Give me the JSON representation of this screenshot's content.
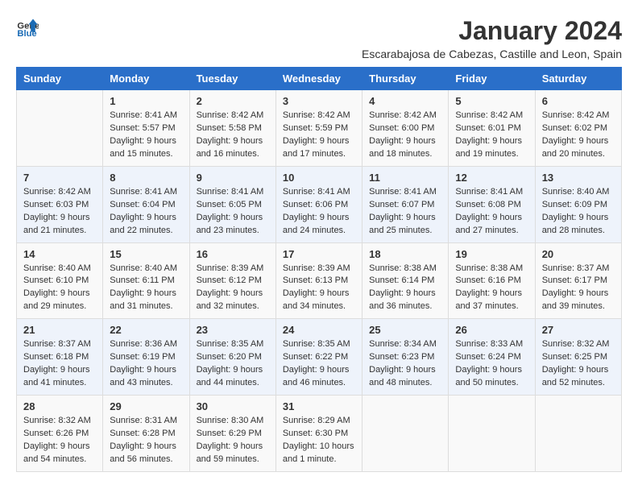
{
  "logo": {
    "general": "General",
    "blue": "Blue"
  },
  "title": "January 2024",
  "subtitle": "Escarabajosa de Cabezas, Castille and Leon, Spain",
  "days_of_week": [
    "Sunday",
    "Monday",
    "Tuesday",
    "Wednesday",
    "Thursday",
    "Friday",
    "Saturday"
  ],
  "weeks": [
    [
      {
        "day": "",
        "content": ""
      },
      {
        "day": "1",
        "content": "Sunrise: 8:41 AM\nSunset: 5:57 PM\nDaylight: 9 hours\nand 15 minutes."
      },
      {
        "day": "2",
        "content": "Sunrise: 8:42 AM\nSunset: 5:58 PM\nDaylight: 9 hours\nand 16 minutes."
      },
      {
        "day": "3",
        "content": "Sunrise: 8:42 AM\nSunset: 5:59 PM\nDaylight: 9 hours\nand 17 minutes."
      },
      {
        "day": "4",
        "content": "Sunrise: 8:42 AM\nSunset: 6:00 PM\nDaylight: 9 hours\nand 18 minutes."
      },
      {
        "day": "5",
        "content": "Sunrise: 8:42 AM\nSunset: 6:01 PM\nDaylight: 9 hours\nand 19 minutes."
      },
      {
        "day": "6",
        "content": "Sunrise: 8:42 AM\nSunset: 6:02 PM\nDaylight: 9 hours\nand 20 minutes."
      }
    ],
    [
      {
        "day": "7",
        "content": "Sunrise: 8:42 AM\nSunset: 6:03 PM\nDaylight: 9 hours\nand 21 minutes."
      },
      {
        "day": "8",
        "content": "Sunrise: 8:41 AM\nSunset: 6:04 PM\nDaylight: 9 hours\nand 22 minutes."
      },
      {
        "day": "9",
        "content": "Sunrise: 8:41 AM\nSunset: 6:05 PM\nDaylight: 9 hours\nand 23 minutes."
      },
      {
        "day": "10",
        "content": "Sunrise: 8:41 AM\nSunset: 6:06 PM\nDaylight: 9 hours\nand 24 minutes."
      },
      {
        "day": "11",
        "content": "Sunrise: 8:41 AM\nSunset: 6:07 PM\nDaylight: 9 hours\nand 25 minutes."
      },
      {
        "day": "12",
        "content": "Sunrise: 8:41 AM\nSunset: 6:08 PM\nDaylight: 9 hours\nand 27 minutes."
      },
      {
        "day": "13",
        "content": "Sunrise: 8:40 AM\nSunset: 6:09 PM\nDaylight: 9 hours\nand 28 minutes."
      }
    ],
    [
      {
        "day": "14",
        "content": "Sunrise: 8:40 AM\nSunset: 6:10 PM\nDaylight: 9 hours\nand 29 minutes."
      },
      {
        "day": "15",
        "content": "Sunrise: 8:40 AM\nSunset: 6:11 PM\nDaylight: 9 hours\nand 31 minutes."
      },
      {
        "day": "16",
        "content": "Sunrise: 8:39 AM\nSunset: 6:12 PM\nDaylight: 9 hours\nand 32 minutes."
      },
      {
        "day": "17",
        "content": "Sunrise: 8:39 AM\nSunset: 6:13 PM\nDaylight: 9 hours\nand 34 minutes."
      },
      {
        "day": "18",
        "content": "Sunrise: 8:38 AM\nSunset: 6:14 PM\nDaylight: 9 hours\nand 36 minutes."
      },
      {
        "day": "19",
        "content": "Sunrise: 8:38 AM\nSunset: 6:16 PM\nDaylight: 9 hours\nand 37 minutes."
      },
      {
        "day": "20",
        "content": "Sunrise: 8:37 AM\nSunset: 6:17 PM\nDaylight: 9 hours\nand 39 minutes."
      }
    ],
    [
      {
        "day": "21",
        "content": "Sunrise: 8:37 AM\nSunset: 6:18 PM\nDaylight: 9 hours\nand 41 minutes."
      },
      {
        "day": "22",
        "content": "Sunrise: 8:36 AM\nSunset: 6:19 PM\nDaylight: 9 hours\nand 43 minutes."
      },
      {
        "day": "23",
        "content": "Sunrise: 8:35 AM\nSunset: 6:20 PM\nDaylight: 9 hours\nand 44 minutes."
      },
      {
        "day": "24",
        "content": "Sunrise: 8:35 AM\nSunset: 6:22 PM\nDaylight: 9 hours\nand 46 minutes."
      },
      {
        "day": "25",
        "content": "Sunrise: 8:34 AM\nSunset: 6:23 PM\nDaylight: 9 hours\nand 48 minutes."
      },
      {
        "day": "26",
        "content": "Sunrise: 8:33 AM\nSunset: 6:24 PM\nDaylight: 9 hours\nand 50 minutes."
      },
      {
        "day": "27",
        "content": "Sunrise: 8:32 AM\nSunset: 6:25 PM\nDaylight: 9 hours\nand 52 minutes."
      }
    ],
    [
      {
        "day": "28",
        "content": "Sunrise: 8:32 AM\nSunset: 6:26 PM\nDaylight: 9 hours\nand 54 minutes."
      },
      {
        "day": "29",
        "content": "Sunrise: 8:31 AM\nSunset: 6:28 PM\nDaylight: 9 hours\nand 56 minutes."
      },
      {
        "day": "30",
        "content": "Sunrise: 8:30 AM\nSunset: 6:29 PM\nDaylight: 9 hours\nand 59 minutes."
      },
      {
        "day": "31",
        "content": "Sunrise: 8:29 AM\nSunset: 6:30 PM\nDaylight: 10 hours\nand 1 minute."
      },
      {
        "day": "",
        "content": ""
      },
      {
        "day": "",
        "content": ""
      },
      {
        "day": "",
        "content": ""
      }
    ]
  ]
}
